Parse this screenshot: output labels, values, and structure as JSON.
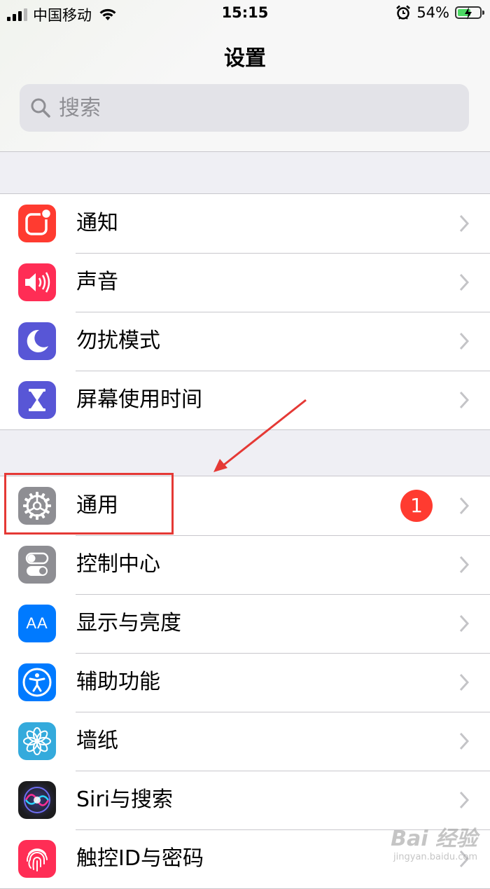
{
  "status": {
    "carrier": "中国移动",
    "time": "15:15",
    "battery": "54%"
  },
  "header": {
    "title": "设置"
  },
  "search": {
    "placeholder": "搜索"
  },
  "group1": [
    {
      "label": "通知",
      "icon": "notifications-icon",
      "color": "#ff3b30"
    },
    {
      "label": "声音",
      "icon": "sounds-icon",
      "color": "#ff2d55"
    },
    {
      "label": "勿扰模式",
      "icon": "moon-icon",
      "color": "#5856d6"
    },
    {
      "label": "屏幕使用时间",
      "icon": "hourglass-icon",
      "color": "#5856d6"
    }
  ],
  "group2": [
    {
      "label": "通用",
      "icon": "gear-icon",
      "color": "#8e8e93",
      "badge": "1"
    },
    {
      "label": "控制中心",
      "icon": "toggles-icon",
      "color": "#8e8e93"
    },
    {
      "label": "显示与亮度",
      "icon": "text-size-icon",
      "color": "#007aff",
      "glyph": "AA"
    },
    {
      "label": "辅助功能",
      "icon": "accessibility-icon",
      "color": "#007aff"
    },
    {
      "label": "墙纸",
      "icon": "flower-icon",
      "color": "#34aadc"
    },
    {
      "label": "Siri与搜索",
      "icon": "siri-icon",
      "color": "#1c1c1e"
    },
    {
      "label": "触控ID与密码",
      "icon": "fingerprint-icon",
      "color": "#ff2d55"
    }
  ],
  "watermark": {
    "brand": "Bai 经验",
    "url": "jingyan.baidu.com"
  }
}
